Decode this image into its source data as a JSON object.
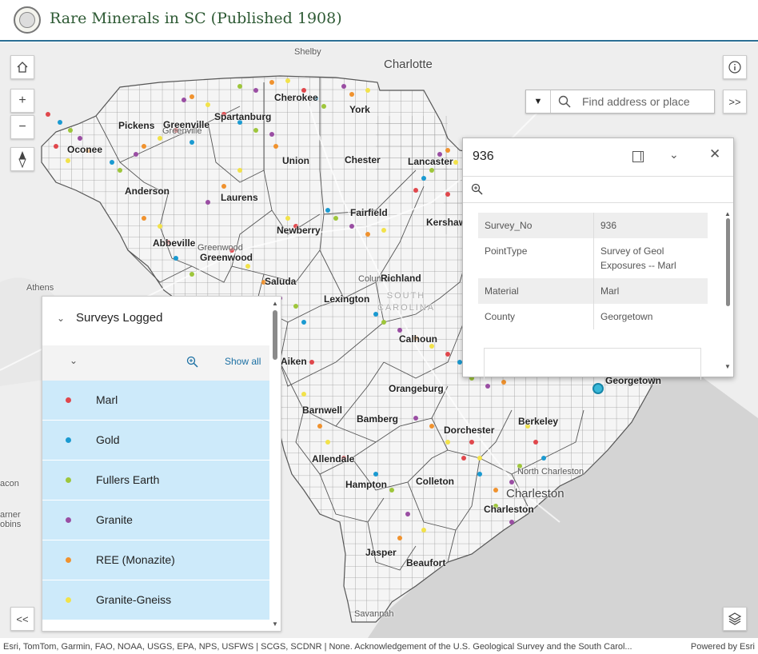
{
  "header": {
    "title": "Rare Minerals in SC (Published 1908)"
  },
  "map_controls": {
    "home_icon": "home-icon",
    "zoom_in": "+",
    "zoom_out": "−",
    "compass_icon": "compass-icon",
    "info_icon": "info-icon",
    "expand_label": ">>",
    "collapse_label": "<<",
    "layers_icon": "layers-icon"
  },
  "search": {
    "placeholder": "Find address or place",
    "dropdown_glyph": "▼"
  },
  "map_labels": {
    "cities": [
      "Shelby",
      "Charlotte",
      "Athens",
      "Savannah",
      "Greenville",
      "Greenwood",
      "Columbia",
      "North Charleston",
      "Charleston",
      "Georgetown",
      "Aiken"
    ],
    "counties": [
      "Pickens",
      "Greenville",
      "Spartanburg",
      "Cherokee",
      "York",
      "Oconee",
      "Anderson",
      "Laurens",
      "Union",
      "Chester",
      "Lancaster",
      "Abbeville",
      "Greenwood",
      "Newberry",
      "Fairfield",
      "Kershaw",
      "Saluda",
      "Lexington",
      "Richland",
      "Calhoun",
      "Aiken",
      "Orangeburg",
      "Barnwell",
      "Bamberg",
      "Dorchester",
      "Berkeley",
      "Allendale",
      "Hampton",
      "Colleton",
      "Charleston",
      "Jasper",
      "Beaufort",
      "Georgetown"
    ],
    "state": "SOUTH CAROLINA",
    "edge_left": [
      "acon",
      "arner",
      "obins"
    ]
  },
  "popup": {
    "title": "936",
    "dock_icon": "dock-icon",
    "collapse_glyph": "⌄",
    "close_glyph": "✕",
    "zoom_icon": "zoom-to-icon",
    "fields": [
      {
        "key": "Survey_No",
        "value": "936"
      },
      {
        "key": "PointType",
        "value": "Survey of Geol Exposures -- Marl"
      },
      {
        "key": "Material",
        "value": "Marl"
      },
      {
        "key": "County",
        "value": "Georgetown"
      }
    ]
  },
  "legend": {
    "title": "Surveys Logged",
    "show_all": "Show all",
    "items": [
      {
        "label": "Marl",
        "color": "#e0474c"
      },
      {
        "label": "Gold",
        "color": "#1a9ad1"
      },
      {
        "label": "Fullers Earth",
        "color": "#9ec63b"
      },
      {
        "label": "Granite",
        "color": "#9a4ea3"
      },
      {
        "label": "REE (Monazite)",
        "color": "#f0922e"
      },
      {
        "label": "Granite-Gneiss",
        "color": "#f2e24a"
      }
    ]
  },
  "attribution": {
    "text": "Esri, TomTom, Garmin, FAO, NOAA, USGS, EPA, NPS, USFWS | SCGS, SCDNR | None. Acknowledgement of the U.S. Geological Survey and the South Carol...",
    "powered_by": "Powered by Esri"
  },
  "colors": {
    "accent": "#2b6e94",
    "title_green": "#2e5a34",
    "legend_bg": "#cdeafa",
    "link": "#1a6fa3"
  }
}
